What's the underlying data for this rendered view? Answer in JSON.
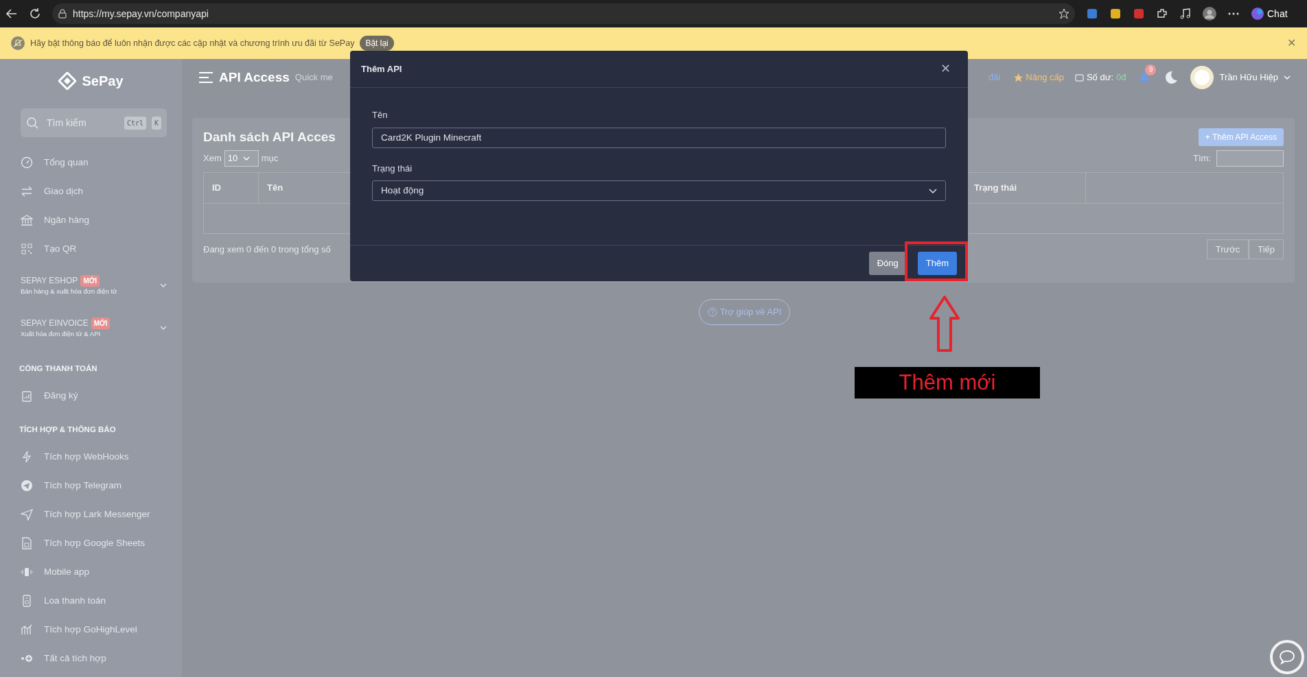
{
  "browser": {
    "url": "https://my.sepay.vn/companyapi",
    "chat_label": "Chat"
  },
  "banner": {
    "text": "Hãy bật thông báo để luôn nhận được các cập nhật và chương trình ưu đãi từ SePay",
    "button": "Bật lại",
    "close": "✕"
  },
  "sidebar": {
    "logo": "SePay",
    "search": {
      "placeholder": "Tìm kiếm",
      "keys": [
        "Ctrl",
        "K"
      ]
    },
    "entries": [
      {
        "kind": "link",
        "label": "Tổng quan"
      },
      {
        "kind": "link",
        "label": "Giao dịch"
      },
      {
        "kind": "link",
        "label": "Ngân hàng"
      },
      {
        "kind": "link",
        "label": "Tạo QR"
      },
      {
        "kind": "group",
        "title": "SEPAY ESHOP",
        "badge": "MỚI",
        "subtitle": "Bán hàng & xuất hóa đơn điện tử",
        "expanded": false
      },
      {
        "kind": "group",
        "title": "SEPAY EINVOICE",
        "badge": "MỚI",
        "subtitle": "Xuất hóa đơn điện tử & API",
        "expanded": false
      },
      {
        "kind": "heading",
        "title": "CỔNG THANH TOÁN"
      },
      {
        "kind": "link",
        "label": "Đăng ký"
      },
      {
        "kind": "heading",
        "title": "TÍCH HỢP & THÔNG BÁO"
      },
      {
        "kind": "link",
        "label": "Tích hợp WebHooks"
      },
      {
        "kind": "link",
        "label": "Tích hợp Telegram"
      },
      {
        "kind": "link",
        "label": "Tích hợp Lark Messenger"
      },
      {
        "kind": "link",
        "label": "Tích hợp Google Sheets"
      },
      {
        "kind": "link",
        "label": "Mobile app"
      },
      {
        "kind": "link",
        "label": "Loa thanh toán"
      },
      {
        "kind": "link",
        "label": "Tích hợp GoHighLevel"
      },
      {
        "kind": "link",
        "label": "Tất cả tích hợp"
      }
    ]
  },
  "header": {
    "title": "API Access",
    "quick": "Quick me",
    "promo_tail": "đãi",
    "upgrade": "Nâng cấp",
    "balance_label": "Số dư:",
    "balance": "0đ",
    "notifications": "9",
    "user": "Trần Hữu Hiệp"
  },
  "card": {
    "title": "Danh sách API Acces",
    "add_button": "+ Thêm API Access",
    "length": {
      "prefix": "Xem",
      "value": "10",
      "suffix": "mục"
    },
    "search_label": "Tìm:",
    "columns": [
      {
        "label": "ID"
      },
      {
        "label": "Tên"
      },
      {
        "label": "Trạng thái"
      }
    ],
    "info": "Đang xem 0 đến 0 trong tổng số",
    "pager": [
      "Trước",
      "Tiếp"
    ]
  },
  "help_button": "Trợ giúp về API",
  "modal": {
    "title": "Thêm API",
    "close": "✕",
    "fields": [
      {
        "kind": "text",
        "label": "Tên",
        "value": "Card2K Plugin Minecraft"
      },
      {
        "kind": "select",
        "label": "Trạng thái",
        "value": "Hoạt động"
      }
    ],
    "buttons": [
      {
        "label": "Đóng",
        "kind": "secondary"
      },
      {
        "label": "Thêm",
        "kind": "primary"
      }
    ]
  },
  "annotation": {
    "text": "Thêm mới"
  }
}
